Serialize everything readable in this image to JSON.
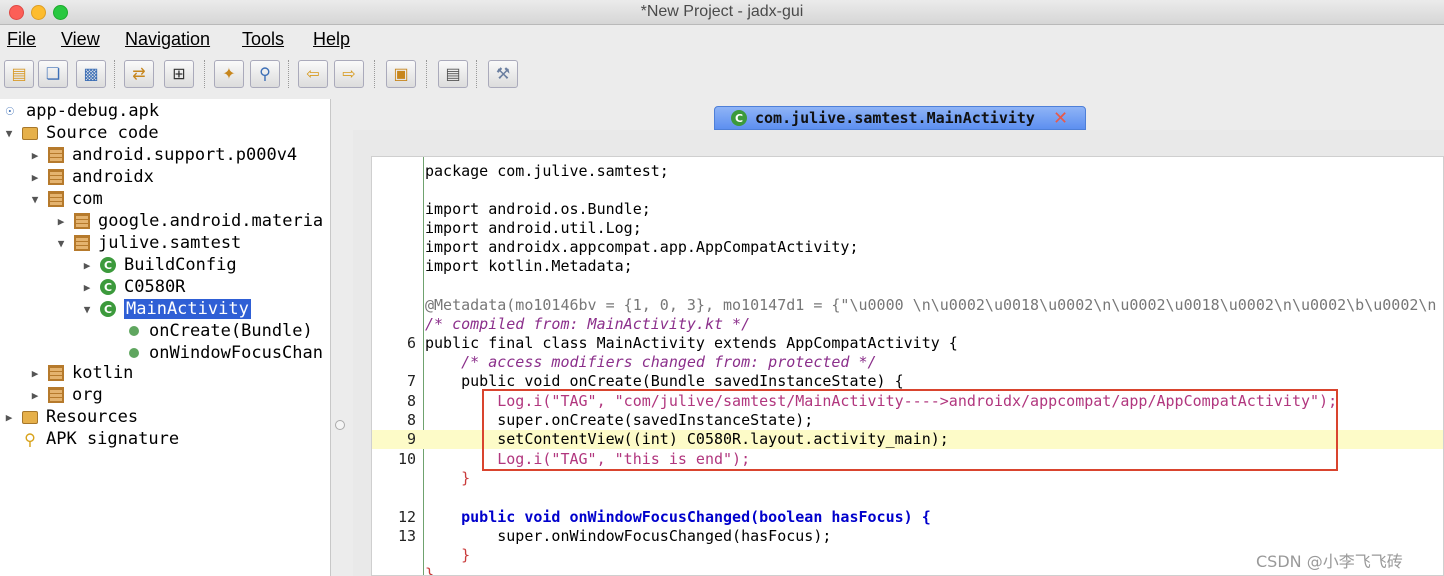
{
  "window": {
    "title": "*New Project - jadx-gui"
  },
  "menu": [
    "File",
    "View",
    "Navigation",
    "Tools",
    "Help"
  ],
  "toolbar_icons": [
    "open-file-icon",
    "add-files-icon",
    "save-all-icon",
    "sync-icon",
    "flatten-packages-icon",
    "decompile-icon",
    "search-icon",
    "back-icon",
    "forward-icon",
    "lock-deobfuscate-icon",
    "log-viewer-icon",
    "preferences-icon"
  ],
  "tree": {
    "root": "app-debug.apk",
    "source_code": "Source code",
    "android_support": "android.support.p000v4",
    "androidx": "androidx",
    "com": "com",
    "google_material": "google.android.materia",
    "julive_samtest": "julive.samtest",
    "build_config": "BuildConfig",
    "c0580r": "C0580R",
    "main_activity": "MainActivity",
    "on_create": "onCreate(Bundle)",
    "on_window_focus": "onWindowFocusChan",
    "kotlin": "kotlin",
    "org": "org",
    "resources": "Resources",
    "apk_signature": "APK signature"
  },
  "tab": {
    "label": "com.julive.samtest.MainActivity",
    "icon_letter": "C"
  },
  "code": {
    "l1": "package com.julive.samtest;",
    "l2": "import android.os.Bundle;",
    "l3": "import android.util.Log;",
    "l4": "import androidx.appcompat.app.AppCompatActivity;",
    "l5": "import kotlin.Metadata;",
    "l6": "@Metadata(mo10146bv = {1, 0, 3}, mo10147d1 = {\"\\u0000 \\n\\u0002\\u0018\\u0002\\n\\u0002\\u0018\\u0002\\n\\u0002\\b\\u0002\\n",
    "l7": "/* compiled from: MainActivity.kt */",
    "l8": "public final class MainActivity extends AppCompatActivity {",
    "l9": "    /* access modifiers changed from: protected */",
    "l10": "    public void onCreate(Bundle savedInstanceState) {",
    "l11": "        Log.i(\"TAG\", \"com/julive/samtest/MainActivity---->androidx/appcompat/app/AppCompatActivity\");",
    "l12": "        super.onCreate(savedInstanceState);",
    "l13": "        setContentView((int) C0580R.layout.activity_main);",
    "l14": "        Log.i(\"TAG\", \"this is end\");",
    "l15": "    }",
    "l16": "    public void onWindowFocusChanged(boolean hasFocus) {",
    "l17": "        super.onWindowFocusChanged(hasFocus);",
    "l18": "    }",
    "l19": "}"
  },
  "line_numbers": {
    "n6": "6",
    "n7": "7",
    "n8": "8",
    "n8b": "8",
    "n9": "9",
    "n10": "10",
    "n12": "12",
    "n13": "13"
  },
  "watermark": "CSDN @小李飞飞砖"
}
